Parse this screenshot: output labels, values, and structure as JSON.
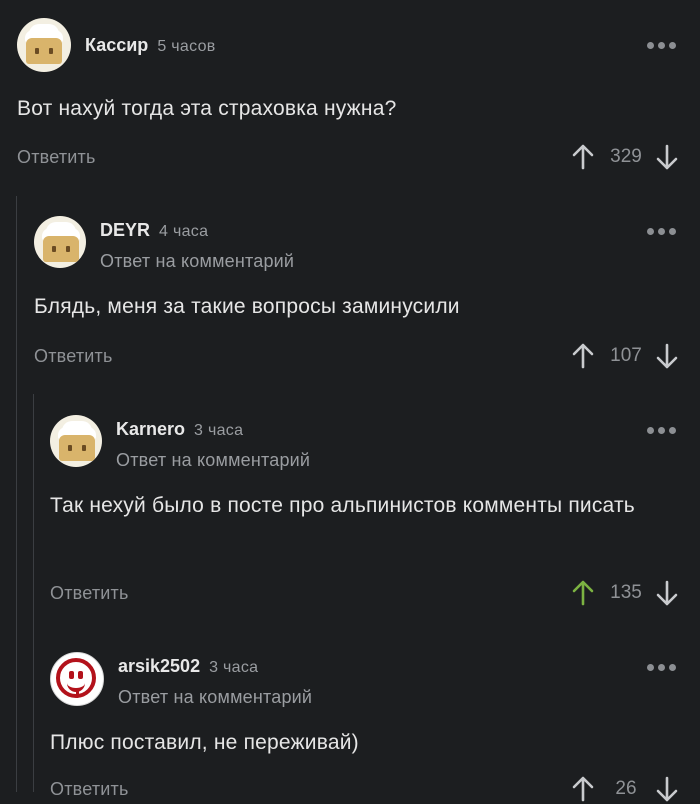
{
  "comments": [
    {
      "user": "Кассир",
      "time": "5 часов",
      "reply_to": "",
      "text": "Вот нахуй тогда эта страховка нужна?",
      "reply_label": "Ответить",
      "score": "329",
      "avatar": "chef-bread"
    },
    {
      "user": "DEYR",
      "time": "4 часа",
      "reply_to": "Ответ на комментарий",
      "text": "Блядь, меня за такие вопросы заминусили",
      "reply_label": "Ответить",
      "score": "107",
      "avatar": "chef-bread"
    },
    {
      "user": "Karnero",
      "time": "3 часа",
      "reply_to": "Ответ на комментарий",
      "text": "Так нехуй было в посте про альпинистов комменты писать",
      "reply_label": "Ответить",
      "score": "135",
      "upvoted": true,
      "avatar": "chef-bread"
    },
    {
      "user": "arsik2502",
      "time": "3 часа",
      "reply_to": "Ответ на комментарий",
      "text": "Плюс поставил, не переживай)",
      "reply_label": "Ответить",
      "score": "26",
      "avatar": "red-smiley"
    }
  ],
  "colors": {
    "background": "#1c1e20",
    "upvote_active": "#7cb342",
    "muted": "#8f9296"
  },
  "icons": [
    "more-dots-icon",
    "upvote-arrow-icon",
    "downvote-arrow-icon"
  ]
}
